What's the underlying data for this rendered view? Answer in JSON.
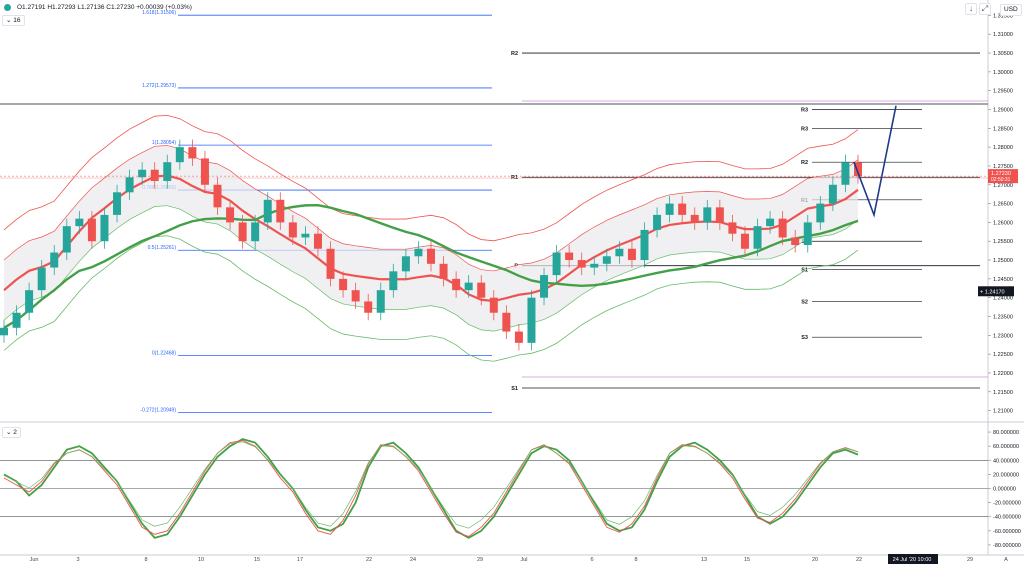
{
  "header": {
    "ohlc": "O1.27191  H1.27293  L1.27136  C1.27230  +0.00039 (+0.03%)",
    "currency": "USD"
  },
  "panes": {
    "main_tag": "16",
    "osc_tag": "2"
  },
  "colors": {
    "up": "#26a69a",
    "down": "#ef5350",
    "fib": "#2962ff",
    "pivot": "#131722",
    "ma_slow": "#43a047",
    "ma_mid": "#e53935",
    "band_upper": "#ef5350",
    "band_lower": "#66bb6a",
    "arrow": "#1e3a8a",
    "violet": "#ce93d8"
  },
  "icons": {
    "status": "status-dot-icon",
    "collapse": "chevron-down-icon",
    "arrow_down": "arrow-down-icon",
    "maximize": "maximize-icon",
    "settings": "gear-icon"
  },
  "chart_data": [
    {
      "type": "candlestick",
      "symbol_pane": "price",
      "ylim": [
        1.2075,
        1.3175
      ],
      "y_ticks": [
        "1.31500",
        "1.31000",
        "1.30500",
        "1.30000",
        "1.29500",
        "1.29000",
        "1.28500",
        "1.28000",
        "1.27500",
        "1.27000",
        "1.26500",
        "1.26000",
        "1.25500",
        "1.25000",
        "1.24500",
        "1.24000",
        "1.23500",
        "1.23000",
        "1.22500",
        "1.22000",
        "1.21500",
        "1.21000"
      ],
      "x_ticks": [
        "Jun",
        "3",
        "8",
        "10",
        "15",
        "17",
        "22",
        "24",
        "29",
        "Jul",
        "6",
        "8",
        "13",
        "15",
        "20",
        "22",
        "24 Jul '20  10:00",
        "29",
        "A"
      ],
      "current_price": {
        "label": "1.27230",
        "countdown": "02:50:31"
      },
      "crosshair_price": "1.24170",
      "ohlc_close_path": [
        1.232,
        1.236,
        1.242,
        1.248,
        1.252,
        1.259,
        1.261,
        1.255,
        1.262,
        1.268,
        1.272,
        1.274,
        1.271,
        1.276,
        1.28,
        1.277,
        1.27,
        1.264,
        1.26,
        1.255,
        1.26,
        1.266,
        1.26,
        1.256,
        1.257,
        1.253,
        1.245,
        1.242,
        1.239,
        1.236,
        1.242,
        1.247,
        1.251,
        1.253,
        1.249,
        1.245,
        1.242,
        1.244,
        1.24,
        1.236,
        1.231,
        1.228,
        1.24,
        1.246,
        1.252,
        1.25,
        1.248,
        1.249,
        1.251,
        1.253,
        1.25,
        1.258,
        1.262,
        1.265,
        1.262,
        1.26,
        1.264,
        1.26,
        1.257,
        1.253,
        1.259,
        1.261,
        1.256,
        1.254,
        1.26,
        1.265,
        1.27,
        1.276,
        1.2723
      ],
      "fibonacci": [
        {
          "label": "1.618(1.31506)",
          "value": 1.31506
        },
        {
          "label": "1.272(1.29573)",
          "value": 1.29573
        },
        {
          "label": "1(1.28054)",
          "value": 1.28054
        },
        {
          "label": "0.786(1.26859)",
          "value": 1.26859
        },
        {
          "label": "0.5(1.25261)",
          "value": 1.25261
        },
        {
          "label": "0(1.22468)",
          "value": 1.22468
        },
        {
          "label": "-0.272(1.20949)",
          "value": 1.20949
        }
      ],
      "pivots_monthly": [
        {
          "label": "R2",
          "value": 1.305
        },
        {
          "label": "R1",
          "value": 1.272
        },
        {
          "label": "P",
          "value": 1.2485
        },
        {
          "label": "S1",
          "value": 1.216
        }
      ],
      "pivots_weekly": [
        {
          "label": "R3",
          "value": 1.29
        },
        {
          "label": "R3",
          "value": 1.285
        },
        {
          "label": "R2",
          "value": 1.276
        },
        {
          "label": "R1",
          "value": 1.266
        },
        {
          "label": "S3",
          "value": 1.255
        },
        {
          "label": "S1",
          "value": 1.2475
        },
        {
          "label": "S2",
          "value": 1.239
        },
        {
          "label": "S3",
          "value": 1.2295
        }
      ],
      "projection": [
        1.276,
        1.262,
        1.291
      ]
    },
    {
      "type": "line",
      "symbol_pane": "oscillator",
      "ylim": [
        -90,
        90
      ],
      "y_ticks": [
        "80.000000",
        "60.000000",
        "40.000000",
        "20.000000",
        "0.000000",
        "-20.000000",
        "-40.000000",
        "-60.000000",
        "-80.000000"
      ],
      "levels": [
        40,
        0,
        -40
      ],
      "series": [
        {
          "values": [
            20,
            10,
            -10,
            5,
            30,
            55,
            60,
            50,
            30,
            10,
            -20,
            -50,
            -70,
            -65,
            -40,
            -10,
            20,
            45,
            60,
            70,
            65,
            45,
            20,
            0,
            -30,
            -55,
            -60,
            -50,
            -20,
            30,
            60,
            65,
            50,
            30,
            0,
            -30,
            -60,
            -70,
            -60,
            -40,
            -10,
            20,
            50,
            60,
            55,
            40,
            10,
            -20,
            -50,
            -60,
            -55,
            -30,
            10,
            45,
            60,
            65,
            55,
            40,
            20,
            -10,
            -40,
            -50,
            -40,
            -20,
            5,
            30,
            50,
            55,
            48
          ]
        },
        {
          "values": [
            15,
            5,
            -5,
            10,
            35,
            50,
            55,
            45,
            25,
            5,
            -25,
            -55,
            -65,
            -60,
            -35,
            -5,
            25,
            50,
            65,
            68,
            60,
            40,
            15,
            -5,
            -35,
            -60,
            -65,
            -45,
            -10,
            35,
            62,
            60,
            45,
            25,
            -5,
            -35,
            -62,
            -68,
            -55,
            -35,
            -5,
            25,
            55,
            62,
            50,
            35,
            5,
            -25,
            -55,
            -62,
            -50,
            -25,
            15,
            50,
            62,
            60,
            50,
            35,
            15,
            -15,
            -42,
            -48,
            -35,
            -15,
            10,
            35,
            52,
            58,
            52
          ]
        }
      ]
    }
  ]
}
